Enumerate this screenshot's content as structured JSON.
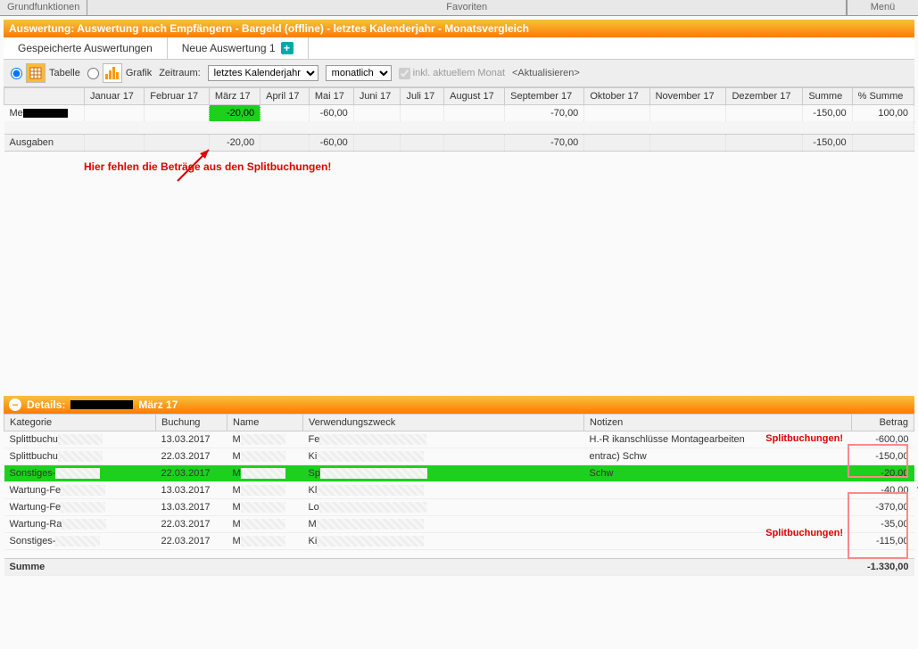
{
  "topbar": {
    "grund": "Grundfunktionen",
    "fav": "Favoriten",
    "menu": "Menü"
  },
  "header": "Auswertung: Auswertung nach Empfängern - Bargeld (offline) - letztes Kalenderjahr - Monatsvergleich",
  "tabs": {
    "saved": "Gespeicherte Auswertungen",
    "new": "Neue Auswertung 1"
  },
  "toolbar": {
    "tabelle": "Tabelle",
    "grafik": "Grafik",
    "zeitraum": "Zeitraum:",
    "zeitraum_val": "letztes Kalenderjahr",
    "period_val": "monatlich",
    "inkl": "inkl. aktuellem Monat",
    "refresh": "<Aktualisieren>"
  },
  "t1": {
    "cols": [
      "",
      "Januar 17",
      "Februar 17",
      "März 17",
      "April 17",
      "Mai 17",
      "Juni 17",
      "Juli 17",
      "August 17",
      "September 17",
      "Oktober 17",
      "November 17",
      "Dezember 17",
      "Summe",
      "% Summe"
    ],
    "row1_label": "Me",
    "row1": {
      "m3": "-20,00",
      "m5": "-60,00",
      "m9": "-70,00",
      "sum": "-150,00",
      "pct": "100,00"
    },
    "row_sum_label": "Ausgaben",
    "row_sum": {
      "m3": "-20,00",
      "m5": "-60,00",
      "m9": "-70,00",
      "sum": "-150,00"
    }
  },
  "note": "Hier fehlen die Beträge aus den Splitbuchungen!",
  "details": {
    "title": "Details:",
    "month": "März 17"
  },
  "t2": {
    "cols": [
      "Kategorie",
      "Buchung",
      "Name",
      "Verwendungszweck",
      "Notizen",
      "Betrag"
    ],
    "label_top": "Splitbuchungen!",
    "label_bot": "Splitbuchungen!",
    "rows": [
      {
        "k": "Splittbuchu",
        "b": "13.03.2017",
        "n": "M",
        "v": "Fe",
        "no": "H.-R            ikanschlüsse Montagearbeiten",
        "bt": "-600,00"
      },
      {
        "k": "Splittbuchu",
        "b": "22.03.2017",
        "n": "M",
        "v": "Ki",
        "no": "entrac)   Schw",
        "bt": "-150,00"
      },
      {
        "k": "Sonstiges-",
        "b": "22.03.2017",
        "n": "M",
        "v": "Sp",
        "no": "Schw",
        "bt": "-20,00",
        "grn": true
      },
      {
        "k": "Wartung-Fe",
        "b": "13.03.2017",
        "n": "M",
        "v": "Kl",
        "no": "",
        "bt": "-40,00"
      },
      {
        "k": "Wartung-Fe",
        "b": "13.03.2017",
        "n": "M",
        "v": "Lo",
        "no": "",
        "bt": "-370,00"
      },
      {
        "k": "Wartung-Ra",
        "b": "22.03.2017",
        "n": "M",
        "v": "M",
        "no": "",
        "bt": "-35,00"
      },
      {
        "k": "Sonstiges-",
        "b": "22.03.2017",
        "n": "M",
        "v": "Ki",
        "no": "",
        "bt": "-115,00"
      }
    ],
    "sum_label": "Summe",
    "sum_val": "-1.330,00"
  }
}
